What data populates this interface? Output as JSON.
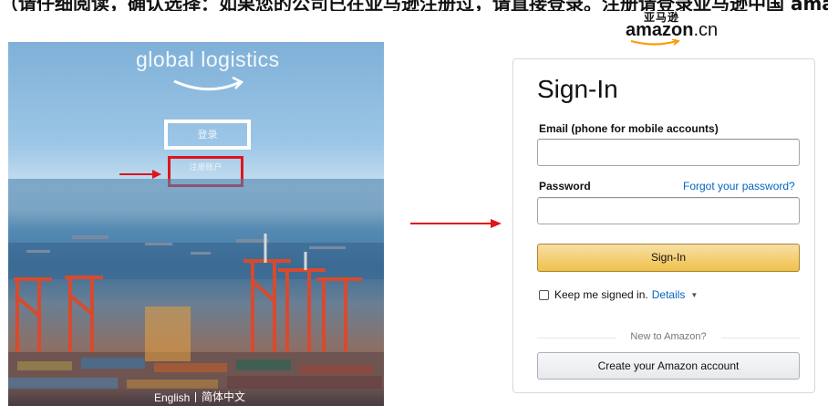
{
  "caption": {
    "text": "（请仔细阅读，确认选择：如果您的公司已在亚马逊注册过，请直接登录。注册请登录亚马逊中国 amazon.cn 操作）"
  },
  "amazon_logo": {
    "chars": "亚马逊",
    "word": "amazon",
    "domain": ".cn"
  },
  "port_page": {
    "title": "global logistics",
    "login_label": "登录",
    "register_label": "注册账户",
    "lang_english": "English",
    "lang_chinese": "简体中文"
  },
  "signin": {
    "title": "Sign-In",
    "email_label": "Email (phone for mobile accounts)",
    "email_value": "",
    "password_label": "Password",
    "password_value": "",
    "forgot_link": "Forgot your password?",
    "signin_button": "Sign-In",
    "keep_signed_in": "Keep me signed in.",
    "details_link": "Details",
    "new_to_amazon": "New to Amazon?",
    "create_account_button": "Create your Amazon account"
  },
  "colors": {
    "link": "#0066c0",
    "signin_button": "#f0c14b",
    "highlight_red": "#e0141c",
    "arrow_red": "#e0141c"
  },
  "icons": [
    "amazon-smile-icon",
    "arrow-right-icon",
    "caret-down-icon",
    "checkbox-icon"
  ]
}
